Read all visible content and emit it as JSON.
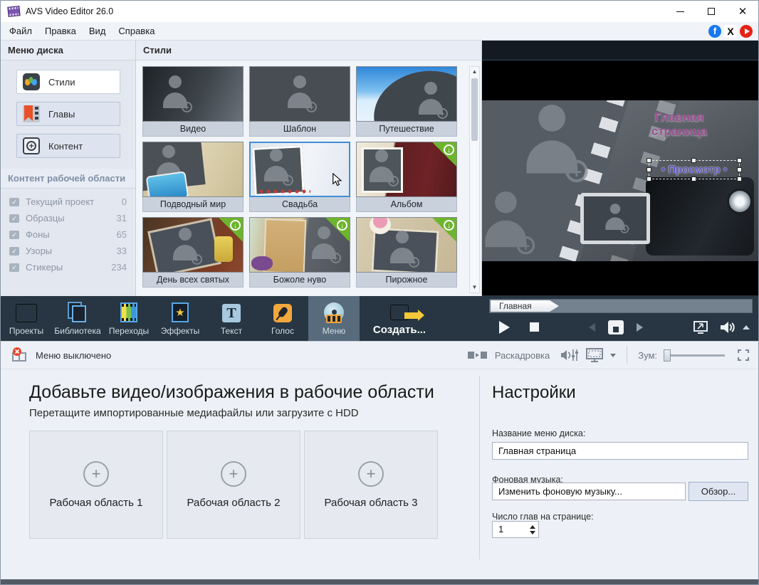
{
  "window": {
    "title": "AVS Video Editor 26.0"
  },
  "menubar": {
    "items": [
      "Файл",
      "Правка",
      "Вид",
      "Справка"
    ]
  },
  "left_panel": {
    "header": "Меню диска",
    "buttons": [
      {
        "label": "Стили",
        "selected": true
      },
      {
        "label": "Главы",
        "selected": false
      },
      {
        "label": "Контент",
        "selected": false
      }
    ],
    "content_header": "Контент рабочей области",
    "items": [
      {
        "label": "Текущий проект",
        "count": "0"
      },
      {
        "label": "Образцы",
        "count": "31"
      },
      {
        "label": "Фоны",
        "count": "65"
      },
      {
        "label": "Узоры",
        "count": "33"
      },
      {
        "label": "Стикеры",
        "count": "234"
      }
    ]
  },
  "styles_panel": {
    "header": "Стили",
    "tiles": [
      {
        "label": "Видео",
        "style": "video",
        "badge": false,
        "selected": false
      },
      {
        "label": "Шаблон",
        "style": "template",
        "badge": false,
        "selected": false
      },
      {
        "label": "Путешествие",
        "style": "travel",
        "badge": false,
        "selected": false
      },
      {
        "label": "Подводный мир",
        "style": "underwater",
        "badge": false,
        "selected": false
      },
      {
        "label": "Свадьба",
        "style": "wedding",
        "badge": false,
        "selected": true
      },
      {
        "label": "Альбом",
        "style": "album",
        "badge": true,
        "selected": false
      },
      {
        "label": "День всех святых",
        "style": "halloween",
        "badge": true,
        "selected": false
      },
      {
        "label": "Божоле нуво",
        "style": "beaujolais",
        "badge": true,
        "selected": false
      },
      {
        "label": "Пирожное",
        "style": "cake",
        "badge": true,
        "selected": false
      }
    ]
  },
  "preview": {
    "title_lines": [
      "Главная",
      "страница"
    ],
    "preview_button": "• Просмотр •"
  },
  "toolbar": {
    "buttons": [
      {
        "label": "Проекты"
      },
      {
        "label": "Библиотека"
      },
      {
        "label": "Переходы"
      },
      {
        "label": "Эффекты"
      },
      {
        "label": "Текст"
      },
      {
        "label": "Голос"
      },
      {
        "label": "Меню",
        "selected": true
      },
      {
        "label": "Создать..."
      }
    ],
    "chapter_tab": "Главная"
  },
  "statusbar": {
    "menu_status": "Меню выключено",
    "storyboard_label": "Раскадровка",
    "zoom_label": "Зум:"
  },
  "workspace": {
    "title": "Добавьте видео/изображения в рабочие области",
    "subtitle": "Перетащите импортированные медиафайлы или загрузите с HDD",
    "areas": [
      "Рабочая область 1",
      "Рабочая область 2",
      "Рабочая область 3"
    ]
  },
  "settings": {
    "title": "Настройки",
    "disc_menu_label": "Название меню диска:",
    "disc_menu_value": "Главная страница",
    "music_label": "Фоновая музыка:",
    "music_value": "Изменить фоновую музыку...",
    "browse_label": "Обзор...",
    "chapters_label": "Число глав на странице:",
    "chapters_value": "1"
  },
  "colors": {
    "toolbar_bg": "#273642",
    "toolbar_selected": "#576b7d",
    "badge_green": "#6cb52c",
    "tile_selected_border": "#3f8fd8",
    "facebook_blue": "#1877f2",
    "youtube_red": "#e62117",
    "preview_title_purple": "#9c4f93",
    "preview_button_violet": "#6058c8"
  }
}
